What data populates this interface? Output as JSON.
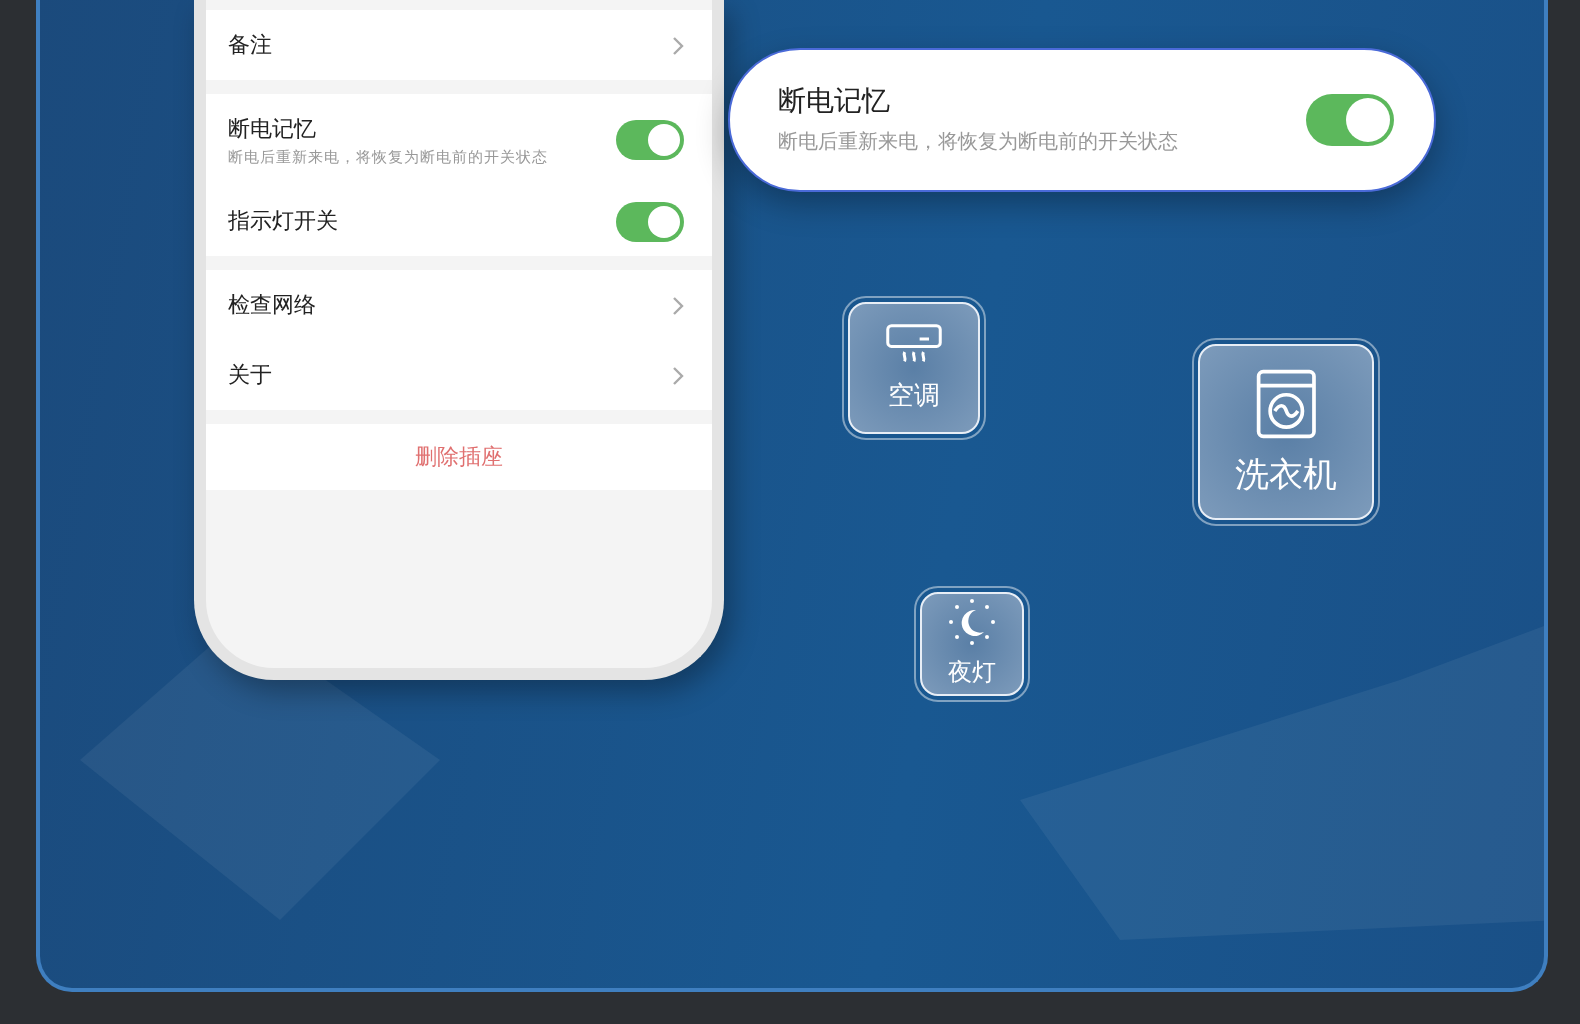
{
  "phone": {
    "sections": [
      {
        "items": [
          {
            "kind": "link",
            "label": "备注"
          }
        ]
      },
      {
        "items": [
          {
            "kind": "toggle",
            "label": "断电记忆",
            "description": "断电后重新来电，将恢复为断电前的开关状态",
            "on": true
          },
          {
            "kind": "toggle",
            "label": "指示灯开关",
            "on": true
          }
        ]
      },
      {
        "items": [
          {
            "kind": "link",
            "label": "检查网络"
          },
          {
            "kind": "link",
            "label": "关于"
          }
        ]
      },
      {
        "items": [
          {
            "kind": "danger",
            "label": "删除插座"
          }
        ]
      }
    ]
  },
  "callout": {
    "title": "断电记忆",
    "description": "断电后重新来电，将恢复为断电前的开关状态",
    "on": true
  },
  "devices": [
    {
      "kind": "air-conditioner",
      "label": "空调"
    },
    {
      "kind": "washing-machine",
      "label": "洗衣机"
    },
    {
      "kind": "night-light",
      "label": "夜灯"
    }
  ]
}
